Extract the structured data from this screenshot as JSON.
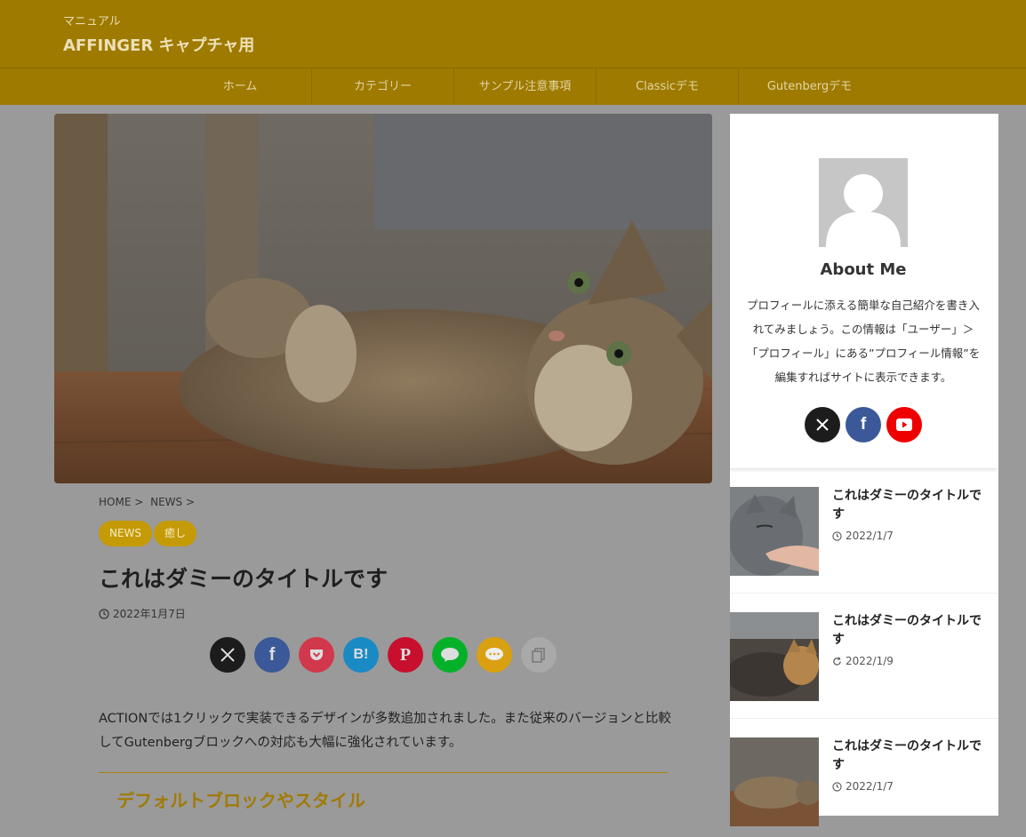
{
  "header": {
    "subtitle": "マニュアル",
    "title": "AFFINGER キャプチャ用"
  },
  "nav": {
    "items": [
      "ホーム",
      "カテゴリー",
      "サンプル注意事項",
      "Classicデモ",
      "Gutenbergデモ"
    ]
  },
  "article": {
    "breadcrumb": [
      "HOME >",
      "NEWS >"
    ],
    "tags": [
      "NEWS",
      "癒し"
    ],
    "title": "これはダミーのタイトルです",
    "date": "2022年1月7日",
    "share_icons": [
      "x-icon",
      "facebook-icon",
      "pocket-icon",
      "hatena-bookmark-icon",
      "pinterest-icon",
      "line-icon",
      "comment-icon",
      "copy-icon"
    ],
    "share_labels": {
      "hatena": "B!"
    },
    "body": "ACTIONでは1クリックで実装できるデザインが多数追加されました。また従来のバージョンと比較してGutenbergブロックへの対応も大幅に強化されています。",
    "heading": "デフォルトブロックやスタイル"
  },
  "sidebar": {
    "about_title": "About Me",
    "about_text": "プロフィールに添える簡単な自己紹介を書き入れてみましょう。この情報は「ユーザー」＞「プロフィール」にある”プロフィール情報”を編集すればサイトに表示できます。",
    "sns_icons": [
      "x-icon",
      "facebook-icon",
      "youtube-icon"
    ],
    "posts": [
      {
        "title": "これはダミーのタイトルです",
        "date": "2022/1/7",
        "date_icon": "clock-icon"
      },
      {
        "title": "これはダミーのタイトルです",
        "date": "2022/1/9",
        "date_icon": "refresh-icon"
      },
      {
        "title": "これはダミーのタイトルです",
        "date": "2022/1/7",
        "date_icon": "clock-icon"
      }
    ]
  },
  "colors": {
    "header_bg": "#9e7a00",
    "page_bg": "#9a9a9a",
    "accent": "#c49a06",
    "x": "#1c1c1c",
    "facebook": "#3b5998",
    "pocket": "#d2384c",
    "hatena": "#1a8ac4",
    "pinterest": "#c8102e",
    "line": "#06b12a",
    "comment": "#d9a011",
    "youtube": "#ee0000"
  }
}
